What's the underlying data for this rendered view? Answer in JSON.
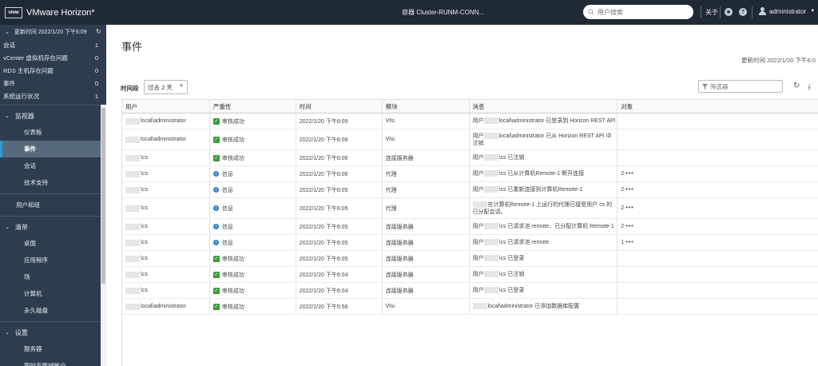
{
  "header": {
    "logo_text": "vmw",
    "app_title": "VMware Horizon*",
    "cluster": "容器 Cluster-RUNM-CONN...",
    "search_placeholder": "用户搜索",
    "about": "关于",
    "user": "administrator"
  },
  "sidebar": {
    "updated": "更新时间 2022/1/20 下午6:09",
    "summary": [
      {
        "label": "会话",
        "count": "1"
      },
      {
        "label": "vCenter 虚拟机存在问题",
        "count": "0"
      },
      {
        "label": "RDS 主机存在问题",
        "count": "0"
      },
      {
        "label": "事件",
        "count": "0"
      },
      {
        "label": "系统运行状况",
        "count": "1"
      }
    ],
    "monitor": {
      "title": "监视器",
      "items": [
        "仪表板",
        "事件",
        "会话",
        "技术支持"
      ]
    },
    "users_groups": "用户和组",
    "inventory": {
      "title": "清单",
      "items": [
        "桌面",
        "应用程序",
        "场",
        "计算机",
        "永久磁盘"
      ]
    },
    "settings": {
      "title": "设置",
      "items": [
        "服务器",
        "即时克隆域帐户"
      ]
    }
  },
  "main": {
    "title": "事件",
    "updated": "更新时间 2022/1/20 下午6:0",
    "period_label": "时间段",
    "period_value": "过去 2 天",
    "filter_placeholder": "筛选器",
    "columns": [
      "用户",
      "严重性",
      "时间",
      "模块",
      "消息",
      "对象"
    ],
    "rows": [
      {
        "user": "local\\administrator",
        "sev": "ok",
        "sev_label": "审核成功",
        "time": "2022/1/20 下午6:09",
        "module": "Vlsi",
        "msg_pre": "用户",
        "msg": "local\\administrator 已登录到 Horizon REST API",
        "obj": "",
        "more": ""
      },
      {
        "user": "local\\administrator",
        "sev": "ok",
        "sev_label": "审核成功",
        "time": "2022/1/20 下午6:08",
        "module": "Vlsi",
        "msg_pre": "用户",
        "msg": "local\\administrator 已从 Horizon REST API 中注销",
        "obj": "",
        "more": ""
      },
      {
        "user": "\\cs",
        "sev": "ok",
        "sev_label": "审核成功",
        "time": "2022/1/20 下午6:06",
        "module": "连接服务器",
        "msg_pre": "用户",
        "msg": "\\cs 已注销",
        "obj": "",
        "more": ""
      },
      {
        "user": "\\cs",
        "sev": "info",
        "sev_label": "信息",
        "time": "2022/1/20 下午6:06",
        "module": "代理",
        "msg_pre": "用户",
        "msg": "\\cs 已从计算机Remote-1 断开连接",
        "obj": "2",
        "more": "•••"
      },
      {
        "user": "\\cs",
        "sev": "info",
        "sev_label": "信息",
        "time": "2022/1/20 下午6:05",
        "module": "代理",
        "msg_pre": "用户",
        "msg": "\\cs 已重新连接到计算机Remote-1",
        "obj": "2",
        "more": "•••"
      },
      {
        "user": "\\cs",
        "sev": "info",
        "sev_label": "信息",
        "time": "2022/1/20 下午6:05",
        "module": "代理",
        "msg_pre": "",
        "msg": "在计算机Remote-1 上运行的代理已接受用户 cs 的已分配会话。",
        "obj": "2",
        "more": "•••"
      },
      {
        "user": "\\cs",
        "sev": "info",
        "sev_label": "信息",
        "time": "2022/1/20 下午6:05",
        "module": "连接服务器",
        "msg_pre": "用户",
        "msg": "\\cs 已请求池 remote，已分配计算机 Remote-1",
        "obj": "2",
        "more": "•••"
      },
      {
        "user": "\\cs",
        "sev": "info",
        "sev_label": "信息",
        "time": "2022/1/20 下午6:05",
        "module": "连接服务器",
        "msg_pre": "用户",
        "msg": "\\cs 已请求池 remote",
        "obj": "1",
        "more": "•••"
      },
      {
        "user": "\\cs",
        "sev": "ok",
        "sev_label": "审核成功",
        "time": "2022/1/20 下午6:05",
        "module": "连接服务器",
        "msg_pre": "用户",
        "msg": "\\cs 已登录",
        "obj": "",
        "more": ""
      },
      {
        "user": "\\cs",
        "sev": "ok",
        "sev_label": "审核成功",
        "time": "2022/1/20 下午6:04",
        "module": "连接服务器",
        "msg_pre": "用户",
        "msg": "\\cs 已注销",
        "obj": "",
        "more": ""
      },
      {
        "user": "\\cs",
        "sev": "ok",
        "sev_label": "审核成功",
        "time": "2022/1/20 下午6:04",
        "module": "连接服务器",
        "msg_pre": "用户",
        "msg": "\\cs 已登录",
        "obj": "",
        "more": ""
      },
      {
        "user": "local\\administrator",
        "sev": "ok",
        "sev_label": "审核成功",
        "time": "2022/1/20 下午5:56",
        "module": "Vlsi",
        "msg_pre": "",
        "msg": "local\\administrator 已添加数据库配置",
        "obj": "",
        "more": ""
      }
    ]
  },
  "colors": {
    "header_bg": "#1f2a36",
    "sidebar_bg": "#2e3d4d",
    "active_bg": "#576a7c",
    "active_accent": "#2b9bd8",
    "success": "#3e9b3a",
    "info": "#2c7fc7"
  },
  "icons": {
    "refresh": "refresh-icon",
    "download": "download-icon",
    "filter": "filter-icon",
    "search": "search-icon",
    "help": "help-icon",
    "notifications": "notification-icon",
    "user": "user-icon"
  }
}
